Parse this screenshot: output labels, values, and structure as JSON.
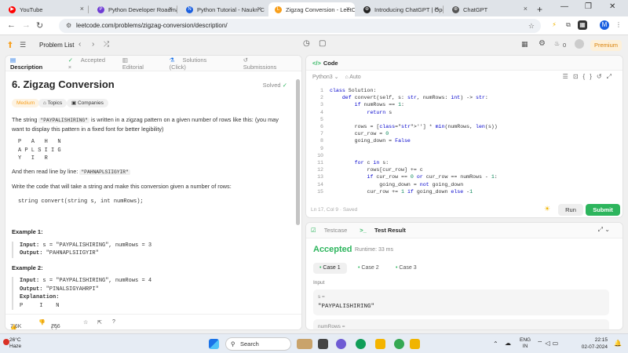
{
  "browser": {
    "tabs": [
      {
        "title": "YouTube",
        "color": "#ff0000",
        "glyph": "▶"
      },
      {
        "title": "Python Developer Roadmap",
        "color": "#6e3bd4",
        "glyph": "P"
      },
      {
        "title": "Python Tutorial - Naukri C",
        "color": "#1a5fe0",
        "glyph": "N"
      },
      {
        "title": "Zigzag Conversion - LeetC",
        "color": "#f89f1b",
        "glyph": "L",
        "active": true
      },
      {
        "title": "Introducing ChatGPT | Ope",
        "color": "#222222",
        "glyph": "⊛"
      },
      {
        "title": "ChatGPT",
        "color": "#555555",
        "glyph": "⊛"
      }
    ],
    "url": "leetcode.com/problems/zigzag-conversion/description/"
  },
  "header": {
    "problem_list": "Problem List",
    "streak": "0",
    "premium": "Premium"
  },
  "left_tabs": {
    "description": "Description",
    "accepted": "Accepted",
    "editorial": "Editorial",
    "solutions": "Solutions",
    "click": "(Click)",
    "submissions": "Submissions"
  },
  "problem": {
    "title": "6. Zigzag Conversion",
    "solved": "Solved",
    "difficulty": "Medium",
    "topics": "Topics",
    "companies": "Companies",
    "p1_a": "The string ",
    "p1_code": "\"PAYPALISHIRING\"",
    "p1_b": " is written in a zigzag pattern on a given number of rows like this: (you may want to display this pattern in a fixed font for better legibility)",
    "pattern": "P   A   H   N\nA P L S I I G\nY   I   R",
    "p2_a": "And then read line by line: ",
    "p2_code": "\"PAHNAPLSIIGYIR\"",
    "p3": "Write the code that will take a string and make this conversion given a number of rows:",
    "signature": "string convert(string s, int numRows);",
    "ex1_title": "Example 1:",
    "ex1_input_label": "Input:",
    "ex1_input": " s = \"PAYPALISHIRING\", numRows = 3",
    "ex1_output_label": "Output:",
    "ex1_output": " \"PAHNAPLSIIGYIR\"",
    "ex2_title": "Example 2:",
    "ex2_input_label": "Input:",
    "ex2_input": " s = \"PAYPALISHIRING\", numRows = 4",
    "ex2_output_label": "Output:",
    "ex2_output": " \"PINALSIGYAHRPI\"",
    "ex2_expl_label": "Explanation:",
    "ex2_expl": "P     I    N"
  },
  "left_footer": {
    "likes": "7.6K",
    "comments": "266"
  },
  "editor": {
    "tab": "Code",
    "language": "Python3",
    "mode": "Auto",
    "status": "Ln 17, Col 9",
    "saved": "Saved",
    "run": "Run",
    "submit": "Submit",
    "lines": [
      {
        "n": "1",
        "code": "class Solution:"
      },
      {
        "n": "2",
        "code": "    def convert(self, s: str, numRows: int) -> str:"
      },
      {
        "n": "3",
        "code": "        if numRows == 1:"
      },
      {
        "n": "4",
        "code": "            return s"
      },
      {
        "n": "5",
        "code": ""
      },
      {
        "n": "6",
        "code": "        rows = [''] * min(numRows, len(s))"
      },
      {
        "n": "7",
        "code": "        cur_row = 0"
      },
      {
        "n": "8",
        "code": "        going_down = False"
      },
      {
        "n": "9",
        "code": ""
      },
      {
        "n": "10",
        "code": ""
      },
      {
        "n": "11",
        "code": "        for c in s:"
      },
      {
        "n": "12",
        "code": "            rows[cur_row] += c"
      },
      {
        "n": "13",
        "code": "            if cur_row == 0 or cur_row == numRows - 1:"
      },
      {
        "n": "14",
        "code": "                going_down = not going_down"
      },
      {
        "n": "15",
        "code": "            cur_row += 1 if going_down else -1"
      }
    ]
  },
  "result": {
    "testcase": "Testcase",
    "test_result": "Test Result",
    "accepted": "Accepted",
    "runtime": "Runtime: 33 ms",
    "cases": [
      "Case 1",
      "Case 2",
      "Case 3"
    ],
    "input_label": "Input",
    "s_label": "s =",
    "s_value": "\"PAYPALISHIRING\"",
    "numrows_label": "numRows ="
  },
  "taskbar": {
    "temp": "26°C",
    "weather": "Haze",
    "search": "Search",
    "lang1": "ENG",
    "lang2": "IN",
    "time": "22:15",
    "date": "02-07-2024"
  }
}
